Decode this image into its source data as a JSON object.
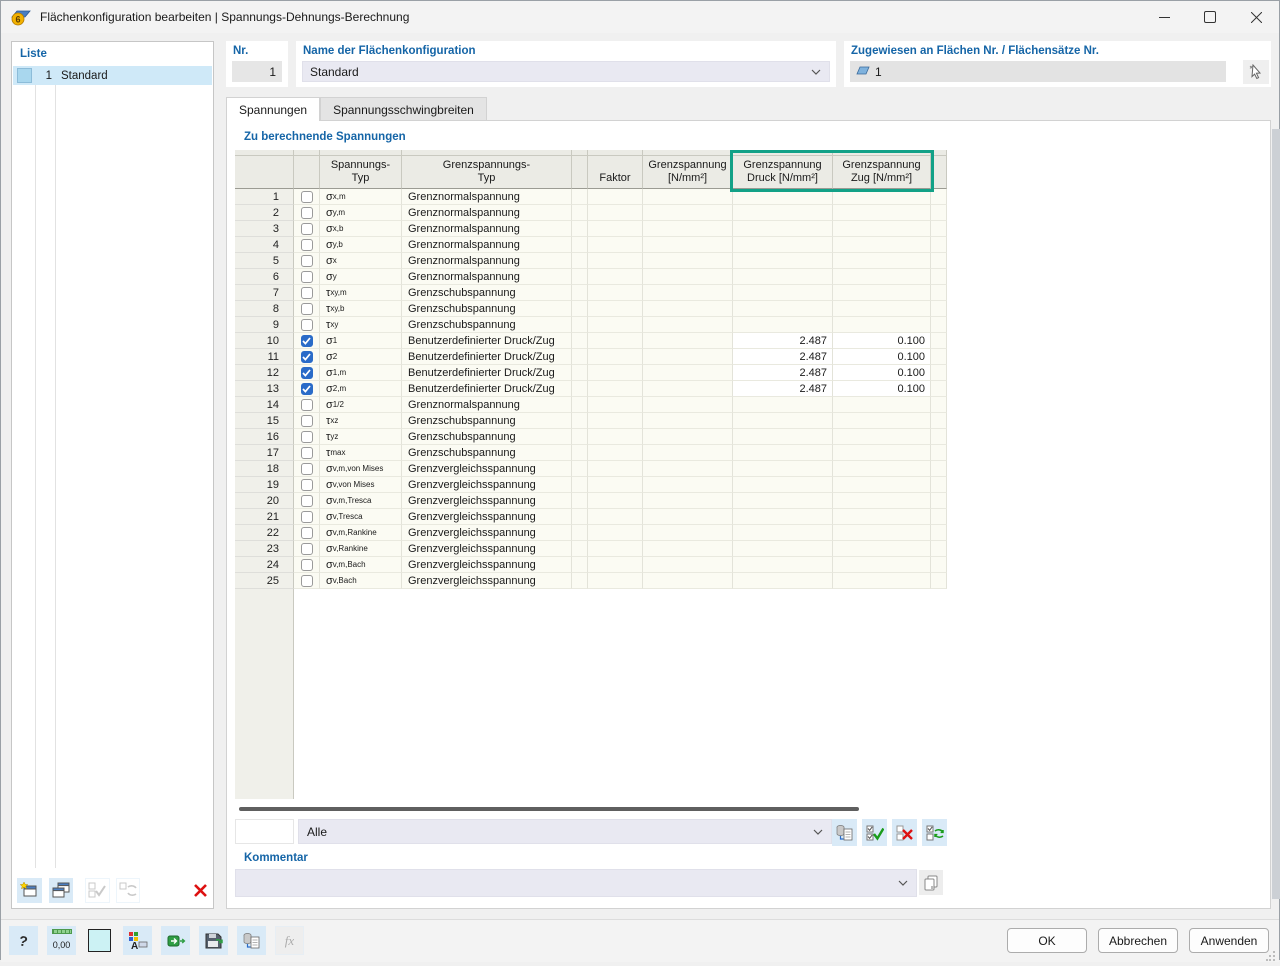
{
  "window": {
    "title": "Flächenkonfiguration bearbeiten | Spannungs-Dehnungs-Berechnung",
    "minimize_glyph": "—",
    "close_glyph": "✕"
  },
  "list_panel": {
    "title": "Liste",
    "items": [
      {
        "nr": "1",
        "name": "Standard",
        "selected": true
      }
    ]
  },
  "fields": {
    "nr_label": "Nr.",
    "nr_value": "1",
    "name_label": "Name der Flächenkonfiguration",
    "name_value": "Standard",
    "assigned_label": "Zugewiesen an Flächen Nr. / Flächensätze Nr.",
    "assigned_value": "1"
  },
  "tabs": {
    "spannungen": "Spannungen",
    "schwingbreiten": "Spannungsschwingbreiten"
  },
  "section": {
    "title": "Zu berechnende Spannungen"
  },
  "table": {
    "headers": {
      "spannungs_typ_1": "Spannungs-",
      "spannungs_typ_2": "Typ",
      "grenzspannungs_typ_1": "Grenzspannungs-",
      "grenzspannungs_typ_2": "Typ",
      "faktor": "Faktor",
      "grenzspannung_1": "Grenzspannung",
      "grenzspannung_2": "[N/mm²]",
      "druck_1": "Grenzspannung",
      "druck_2": "Druck [N/mm²]",
      "zug_1": "Grenzspannung",
      "zug_2": "Zug [N/mm²]"
    },
    "rows": [
      {
        "nr": "1",
        "checked": false,
        "sym": "σ",
        "sub": "x,m",
        "typ": "Grenznormalspannung",
        "faktor": "",
        "grenz": "",
        "druck": "",
        "zug": ""
      },
      {
        "nr": "2",
        "checked": false,
        "sym": "σ",
        "sub": "y,m",
        "typ": "Grenznormalspannung",
        "faktor": "",
        "grenz": "",
        "druck": "",
        "zug": ""
      },
      {
        "nr": "3",
        "checked": false,
        "sym": "σ",
        "sub": "x,b",
        "typ": "Grenznormalspannung",
        "faktor": "",
        "grenz": "",
        "druck": "",
        "zug": ""
      },
      {
        "nr": "4",
        "checked": false,
        "sym": "σ",
        "sub": "y,b",
        "typ": "Grenznormalspannung",
        "faktor": "",
        "grenz": "",
        "druck": "",
        "zug": ""
      },
      {
        "nr": "5",
        "checked": false,
        "sym": "σ",
        "sub": "x",
        "typ": "Grenznormalspannung",
        "faktor": "",
        "grenz": "",
        "druck": "",
        "zug": ""
      },
      {
        "nr": "6",
        "checked": false,
        "sym": "σ",
        "sub": "y",
        "typ": "Grenznormalspannung",
        "faktor": "",
        "grenz": "",
        "druck": "",
        "zug": ""
      },
      {
        "nr": "7",
        "checked": false,
        "sym": "τ",
        "sub": "xy,m",
        "typ": "Grenzschubspannung",
        "faktor": "",
        "grenz": "",
        "druck": "",
        "zug": ""
      },
      {
        "nr": "8",
        "checked": false,
        "sym": "τ",
        "sub": "xy,b",
        "typ": "Grenzschubspannung",
        "faktor": "",
        "grenz": "",
        "druck": "",
        "zug": ""
      },
      {
        "nr": "9",
        "checked": false,
        "sym": "τ",
        "sub": "xy",
        "typ": "Grenzschubspannung",
        "faktor": "",
        "grenz": "",
        "druck": "",
        "zug": ""
      },
      {
        "nr": "10",
        "checked": true,
        "sym": "σ",
        "sub": "1",
        "typ": "Benutzerdefinierter Druck/Zug",
        "faktor": "",
        "grenz": "",
        "druck": "2.487",
        "zug": "0.100"
      },
      {
        "nr": "11",
        "checked": true,
        "sym": "σ",
        "sub": "2",
        "typ": "Benutzerdefinierter Druck/Zug",
        "faktor": "",
        "grenz": "",
        "druck": "2.487",
        "zug": "0.100"
      },
      {
        "nr": "12",
        "checked": true,
        "sym": "σ",
        "sub": "1,m",
        "typ": "Benutzerdefinierter Druck/Zug",
        "faktor": "",
        "grenz": "",
        "druck": "2.487",
        "zug": "0.100"
      },
      {
        "nr": "13",
        "checked": true,
        "sym": "σ",
        "sub": "2,m",
        "typ": "Benutzerdefinierter Druck/Zug",
        "faktor": "",
        "grenz": "",
        "druck": "2.487",
        "zug": "0.100"
      },
      {
        "nr": "14",
        "checked": false,
        "sym": "σ",
        "sub": "1/2",
        "typ": "Grenznormalspannung",
        "faktor": "",
        "grenz": "",
        "druck": "",
        "zug": ""
      },
      {
        "nr": "15",
        "checked": false,
        "sym": "τ",
        "sub": "xz",
        "typ": "Grenzschubspannung",
        "faktor": "",
        "grenz": "",
        "druck": "",
        "zug": ""
      },
      {
        "nr": "16",
        "checked": false,
        "sym": "τ",
        "sub": "yz",
        "typ": "Grenzschubspannung",
        "faktor": "",
        "grenz": "",
        "druck": "",
        "zug": ""
      },
      {
        "nr": "17",
        "checked": false,
        "sym": "τ",
        "sub": "max",
        "typ": "Grenzschubspannung",
        "faktor": "",
        "grenz": "",
        "druck": "",
        "zug": ""
      },
      {
        "nr": "18",
        "checked": false,
        "sym": "σ",
        "sub": "v,m,von Mises",
        "typ": "Grenzvergleichsspannung",
        "faktor": "",
        "grenz": "",
        "druck": "",
        "zug": ""
      },
      {
        "nr": "19",
        "checked": false,
        "sym": "σ",
        "sub": "v,von Mises",
        "typ": "Grenzvergleichsspannung",
        "faktor": "",
        "grenz": "",
        "druck": "",
        "zug": ""
      },
      {
        "nr": "20",
        "checked": false,
        "sym": "σ",
        "sub": "v,m,Tresca",
        "typ": "Grenzvergleichsspannung",
        "faktor": "",
        "grenz": "",
        "druck": "",
        "zug": ""
      },
      {
        "nr": "21",
        "checked": false,
        "sym": "σ",
        "sub": "v,Tresca",
        "typ": "Grenzvergleichsspannung",
        "faktor": "",
        "grenz": "",
        "druck": "",
        "zug": ""
      },
      {
        "nr": "22",
        "checked": false,
        "sym": "σ",
        "sub": "v,m,Rankine",
        "typ": "Grenzvergleichsspannung",
        "faktor": "",
        "grenz": "",
        "druck": "",
        "zug": ""
      },
      {
        "nr": "23",
        "checked": false,
        "sym": "σ",
        "sub": "v,Rankine",
        "typ": "Grenzvergleichsspannung",
        "faktor": "",
        "grenz": "",
        "druck": "",
        "zug": ""
      },
      {
        "nr": "24",
        "checked": false,
        "sym": "σ",
        "sub": "v,m,Bach",
        "typ": "Grenzvergleichsspannung",
        "faktor": "",
        "grenz": "",
        "druck": "",
        "zug": ""
      },
      {
        "nr": "25",
        "checked": false,
        "sym": "σ",
        "sub": "v,Bach",
        "typ": "Grenzvergleichsspannung",
        "faktor": "",
        "grenz": "",
        "druck": "",
        "zug": ""
      }
    ]
  },
  "filter": {
    "value": "Alle"
  },
  "comment": {
    "label": "Kommentar",
    "value": ""
  },
  "footer": {
    "ok": "OK",
    "cancel": "Abbrechen",
    "apply": "Anwenden"
  },
  "toolbar_glyphs": {
    "help": "?",
    "decimals": "0,00",
    "display": "A",
    "function": "fx"
  },
  "colors": {
    "highlight_frame": "#12a187",
    "checkbox_checked": "#2a6bc8",
    "accent_label": "#1565a7",
    "selected_row": "#cfe9f8"
  }
}
